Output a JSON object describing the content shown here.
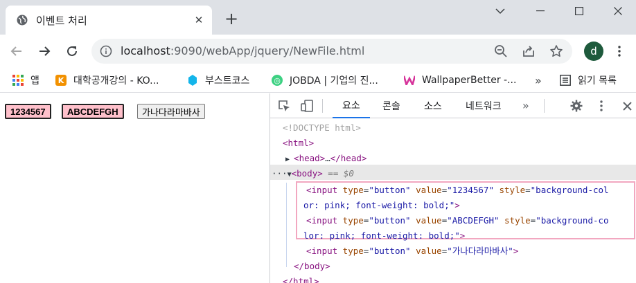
{
  "browser": {
    "tab": {
      "title": "이벤트 처리",
      "close": "✕"
    },
    "new_tab": "+",
    "address": {
      "host": "localhost",
      "rest": ":9090/webApp/jquery/NewFile.html"
    },
    "avatar_letter": "d"
  },
  "bookmarks": [
    {
      "label": "앱",
      "icon": "apps-grid-icon"
    },
    {
      "label": "대학공개강의 - KO...",
      "icon": "kocw-icon"
    },
    {
      "label": "부스트코스",
      "icon": "boostcourse-icon"
    },
    {
      "label": "JOBDA | 기업의 진...",
      "icon": "jobda-icon"
    },
    {
      "label": "WallpaperBetter -...",
      "icon": "wallpaperbetter-icon"
    }
  ],
  "bookmarks_more": "»",
  "reading_list": "읽기 목록",
  "page": {
    "buttons": [
      {
        "label": "1234567",
        "styled": true
      },
      {
        "label": "ABCDEFGH",
        "styled": true
      },
      {
        "label": "가나다라마바사",
        "styled": false
      }
    ]
  },
  "devtools": {
    "tabs": [
      "요소",
      "콘솔",
      "소스",
      "네트워크"
    ],
    "more_tabs": "»",
    "dom": {
      "doctype": "<!DOCTYPE html>",
      "html_open": "<html>",
      "head_open": "<head>",
      "head_ellipsis": "…",
      "head_close": "</head>",
      "body_dots": "···",
      "body_open": "<body>",
      "body_marker": " == $0",
      "input1_l1": {
        "open": "<input",
        "a1": " type",
        "v1": "\"button\"",
        "a2": " value",
        "v2": "\"1234567\"",
        "a3": " style",
        "v3": "\"background-col"
      },
      "input1_l2": "or: pink; font-weight: bold;\"",
      "input2_l1": {
        "open": "<input",
        "a1": " type",
        "v1": "\"button\"",
        "a2": " value",
        "v2": "\"ABCDEFGH\"",
        "a3": " style",
        "v3": "\"background-co"
      },
      "input2_l2": "lor: pink; font-weight: bold;\"",
      "input3": {
        "open": "<input",
        "a1": " type",
        "v1": "\"button\"",
        "a2": " value",
        "v2": "\"가나다라마바사\""
      },
      "close_gt": ">",
      "eq": "=",
      "body_close": "</body>",
      "html_close": "</html>"
    },
    "highlight_color": "#f2a7c0"
  }
}
